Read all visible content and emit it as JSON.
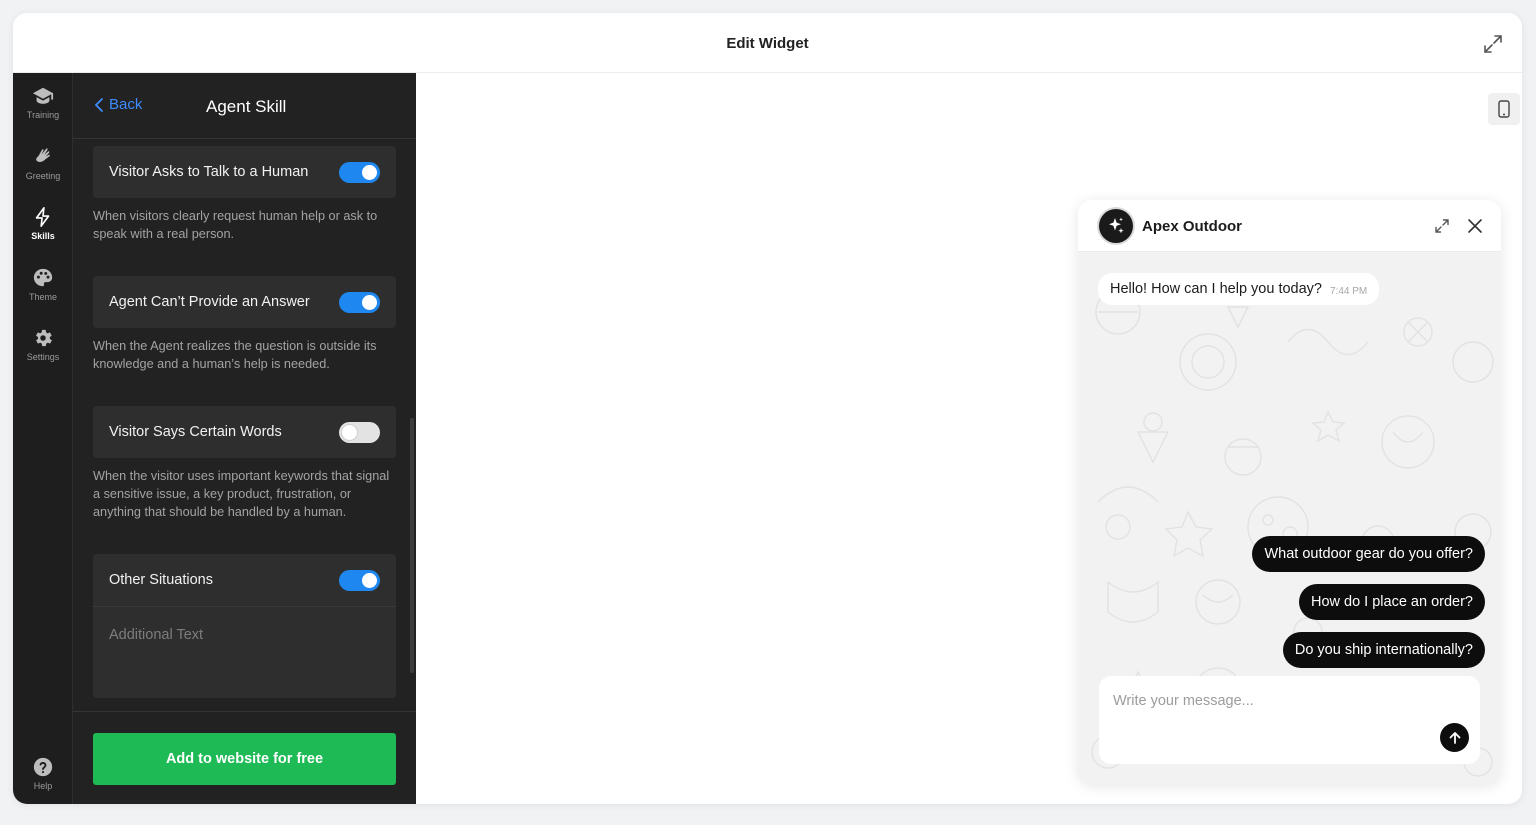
{
  "window": {
    "title": "Edit Widget"
  },
  "rail": {
    "items": [
      {
        "label": "Training",
        "icon": "graduation-cap-icon"
      },
      {
        "label": "Greeting",
        "icon": "waving-hand-icon"
      },
      {
        "label": "Skills",
        "icon": "lightning-bolt-icon",
        "active": true
      },
      {
        "label": "Theme",
        "icon": "palette-icon"
      },
      {
        "label": "Settings",
        "icon": "gear-icon"
      }
    ],
    "help": {
      "label": "Help",
      "icon": "question-circle-icon"
    }
  },
  "panel": {
    "back_label": "Back",
    "title": "Agent Skill",
    "skills": [
      {
        "label": "Visitor Asks to Talk to a Human",
        "enabled": true,
        "description": "When visitors clearly request human help or ask to speak with a real person."
      },
      {
        "label": "Agent Can’t Provide an Answer",
        "enabled": true,
        "description": "When the Agent realizes the question is outside its knowledge and a human’s help is needed."
      },
      {
        "label": "Visitor Says Certain Words",
        "enabled": false,
        "description": "When the visitor uses important keywords that signal a sensitive issue, a key product, frustration, or anything that should be handled by a human."
      },
      {
        "label": "Other Situations",
        "enabled": true,
        "placeholder": "Additional Text"
      }
    ],
    "cta_label": "Add to website for free"
  },
  "chat": {
    "name": "Apex Outdoor",
    "greeting": "Hello! How can I help you today?",
    "greeting_time": "7:44 PM",
    "suggestions": [
      "What outdoor gear do you offer?",
      "How do I place an order?",
      "Do you ship internationally?"
    ],
    "input_placeholder": "Write your message..."
  },
  "colors": {
    "accent_blue": "#1e88f0",
    "cta_green": "#1dba55",
    "panel_bg": "#222222",
    "rail_bg": "#1e1e1e"
  }
}
